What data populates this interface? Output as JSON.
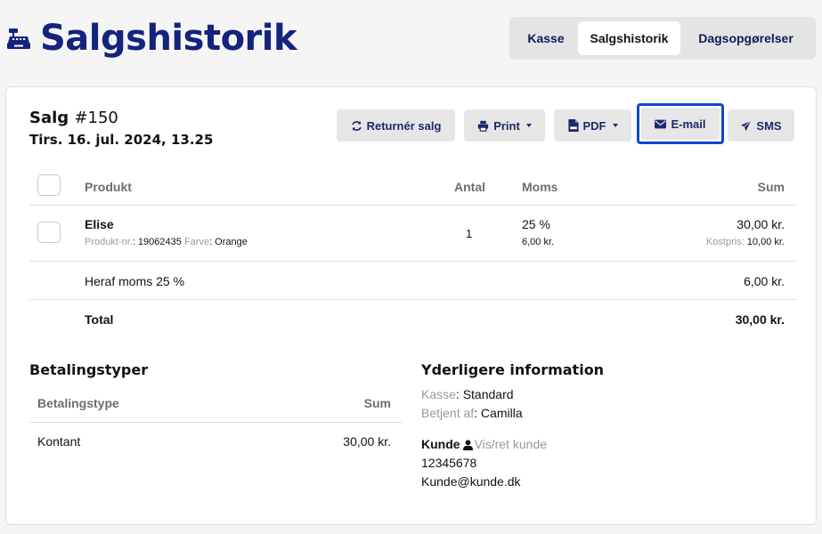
{
  "header": {
    "title": "Salgshistorik",
    "title_icon": "cash-register-icon",
    "brand_color": "#14237d",
    "tabs": [
      {
        "label": "Kasse",
        "active": false
      },
      {
        "label": "Salgshistorik",
        "active": true
      },
      {
        "label": "Dagsopgørelser",
        "active": false
      }
    ]
  },
  "sale": {
    "title_prefix": "Salg ",
    "title_number": "#150",
    "date": "Tirs. 16. jul. 2024, 13.25"
  },
  "toolbar": {
    "return_label": "Returnér salg",
    "print_label": "Print",
    "pdf_label": "PDF",
    "email_label": "E-mail",
    "sms_label": "SMS",
    "focus_color": "#0d47c9"
  },
  "products": {
    "columns": {
      "product": "Produkt",
      "quantity": "Antal",
      "vat": "Moms",
      "sum": "Sum"
    },
    "rows": [
      {
        "name": "Elise",
        "product_no_label": "Produkt-nr.",
        "product_no": ": 19062435",
        "color_label": "Farve",
        "color_value": ": Orange",
        "quantity": "1",
        "vat_rate": "25 %",
        "vat_amount": "6,00 kr.",
        "sum": "30,00 kr.",
        "cost_label": "Kostpris:",
        "cost_value": " 10,00 kr."
      }
    ],
    "vat_row": {
      "label": "Heraf moms 25 %",
      "value": "6,00 kr."
    },
    "total_row": {
      "label": "Total",
      "value": "30,00 kr."
    }
  },
  "payments": {
    "title": "Betalingstyper",
    "columns": {
      "type": "Betalingstype",
      "sum": "Sum"
    },
    "rows": [
      {
        "type": "Kontant",
        "sum": "30,00 kr."
      }
    ]
  },
  "info": {
    "title": "Yderligere information",
    "register_label": "Kasse",
    "register_value": ": Standard",
    "served_label": "Betjent af",
    "served_value": ": Camilla",
    "customer_label": "Kunde",
    "customer_link": "Vis/ret kunde",
    "customer_phone": "12345678",
    "customer_email": "Kunde@kunde.dk"
  }
}
